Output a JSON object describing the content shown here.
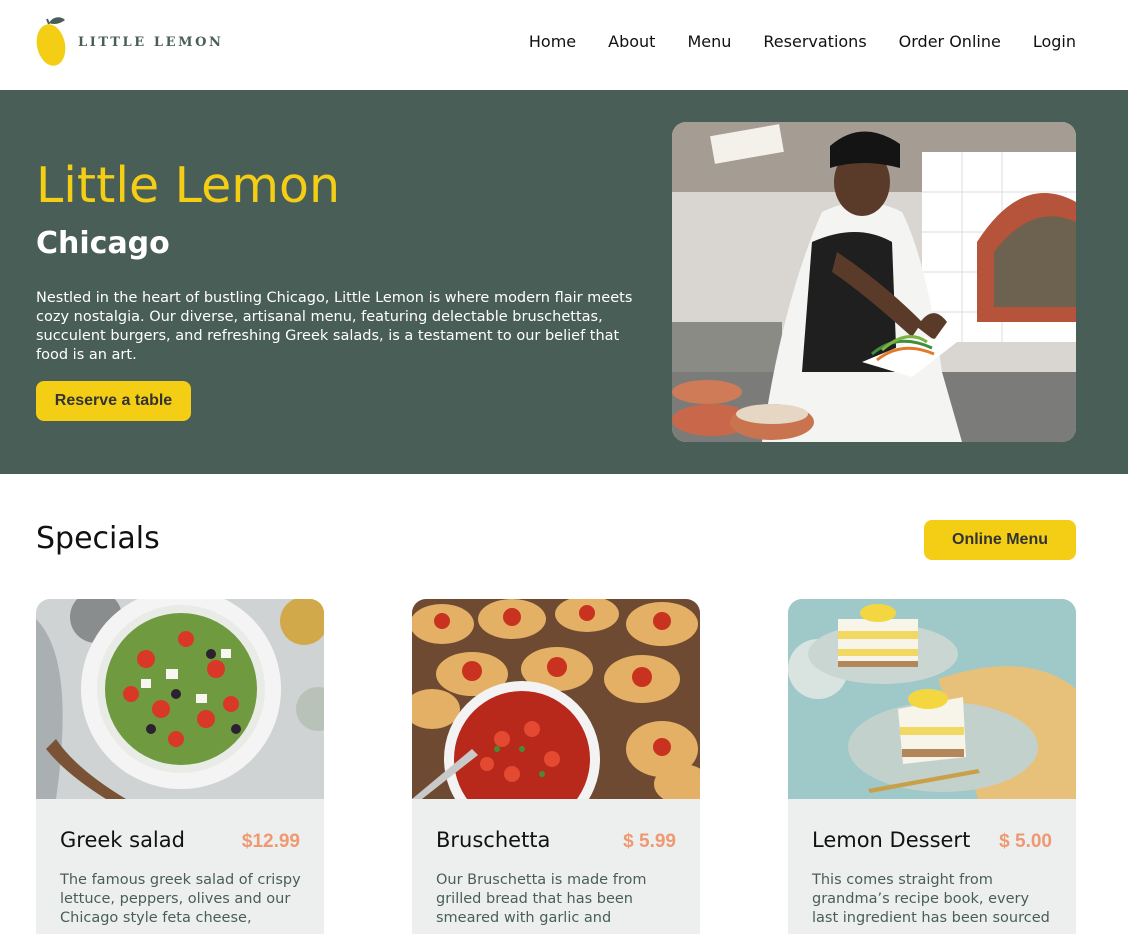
{
  "brand": {
    "name": "LITTLE LEMON"
  },
  "nav": {
    "items": [
      "Home",
      "About",
      "Menu",
      "Reservations",
      "Order Online",
      "Login"
    ]
  },
  "hero": {
    "title": "Little Lemon",
    "subtitle": "Chicago",
    "description": "Nestled in the heart of bustling Chicago, Little Lemon is where modern flair meets cozy nostalgia. Our diverse, artisanal menu, featuring delectable bruschettas, succulent burgers, and refreshing Greek salads, is a testament to our belief that food is an art.",
    "cta": "Reserve a table"
  },
  "specials": {
    "title": "Specials",
    "menu_button": "Online Menu",
    "cards": [
      {
        "name": "Greek salad",
        "price": "$12.99",
        "description": "The famous greek salad of crispy lettuce, peppers, olives and our Chicago style feta cheese,"
      },
      {
        "name": "Bruschetta",
        "price": "$ 5.99",
        "description": "Our Bruschetta is made from grilled bread that has been smeared with garlic and"
      },
      {
        "name": "Lemon Dessert",
        "price": "$ 5.00",
        "description": "This comes straight from grandma’s recipe book, every last ingredient has been sourced"
      }
    ]
  },
  "colors": {
    "primary_green": "#495e57",
    "primary_yellow": "#f4ce14",
    "accent_salmon": "#ee9972",
    "card_bg": "#edefee"
  }
}
